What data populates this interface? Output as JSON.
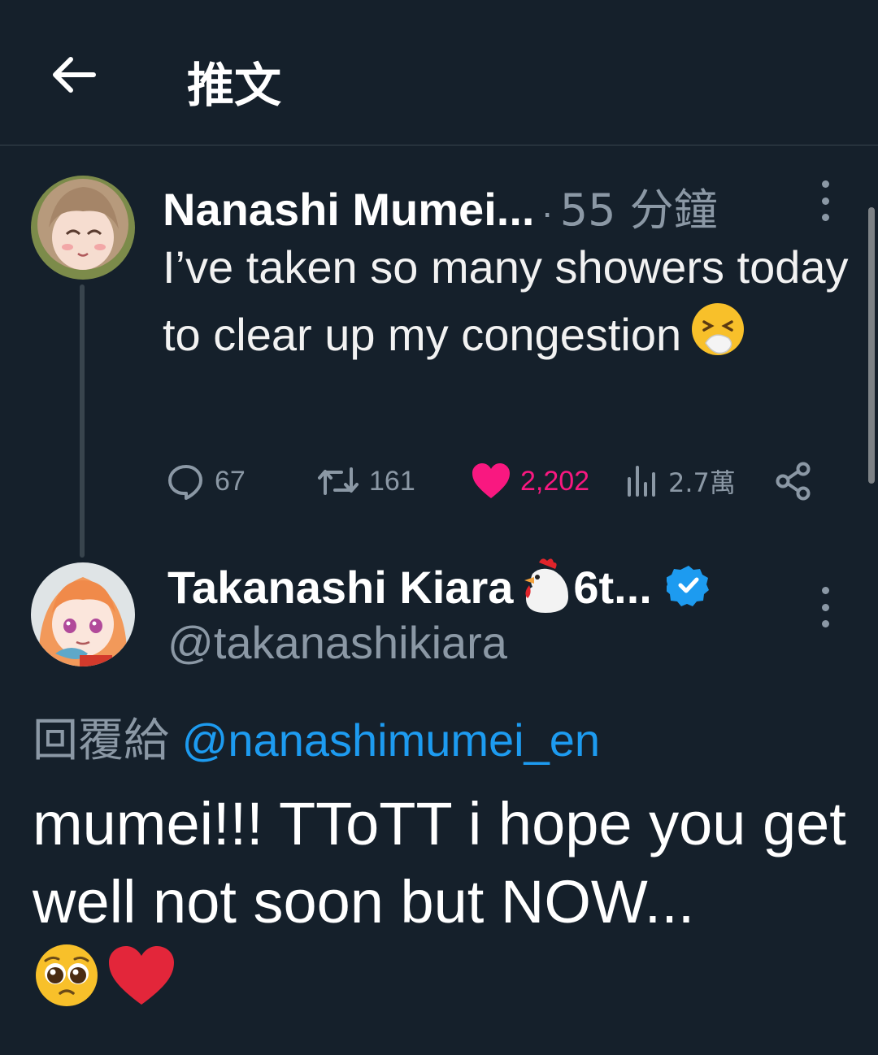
{
  "header": {
    "title": "推文",
    "back_icon": "arrow-left-icon"
  },
  "tweet1": {
    "author_name": "Nanashi Mumei...",
    "separator": "·",
    "time": "55 分鐘",
    "text": "I’ve taken so many showers today to clear up my congestion",
    "emoji": "sneezing-face-icon",
    "stats": {
      "replies": "67",
      "retweets": "161",
      "likes": "2,202",
      "views": "2.7萬"
    },
    "like_color": "#f91880"
  },
  "tweet2": {
    "author_name": "Takanashi Kiara",
    "author_name_suffix": "6t...",
    "name_emoji": "rooster-icon",
    "verified_icon": "verified-badge-icon",
    "handle": "@takanashikiara",
    "reply_label": "回覆給",
    "reply_mention": "@nanashimumei_en",
    "text": "mumei!!! TToTT i hope you get well not soon but NOW...",
    "trailing_emojis": [
      "pleading-face-icon",
      "red-heart-icon"
    ]
  },
  "colors": {
    "background": "#15202b",
    "muted": "#8b98a5",
    "accent": "#1d9bf0"
  }
}
